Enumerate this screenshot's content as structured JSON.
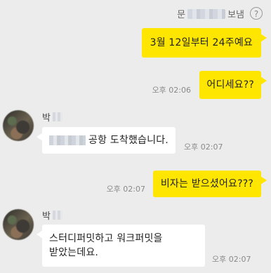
{
  "header": {
    "sender_prefix": "문",
    "sender_suffix": "보냄",
    "help_symbol": "?"
  },
  "messages": [
    {
      "from": "me",
      "text": "3월 12일부터 24주예요",
      "time": ""
    },
    {
      "from": "me",
      "text": "어디세요??",
      "time": "오후 02:06"
    },
    {
      "from": "other",
      "name": "박",
      "text": "공항 도착했습니다.",
      "time": "오후 02:07"
    },
    {
      "from": "me",
      "text": "비자는 받으셨어요???",
      "time": "오후 02:07"
    },
    {
      "from": "other",
      "name": "박",
      "text": "스터디퍼밋하고 워크퍼밋을 받았는데요.",
      "time": "오후 02:07"
    }
  ],
  "colors": {
    "background": "#ececec",
    "my_bubble": "#ffe600",
    "other_bubble": "#ffffff",
    "time_text": "#8a8a8a"
  },
  "icons": [
    "help-icon",
    "avatar"
  ]
}
